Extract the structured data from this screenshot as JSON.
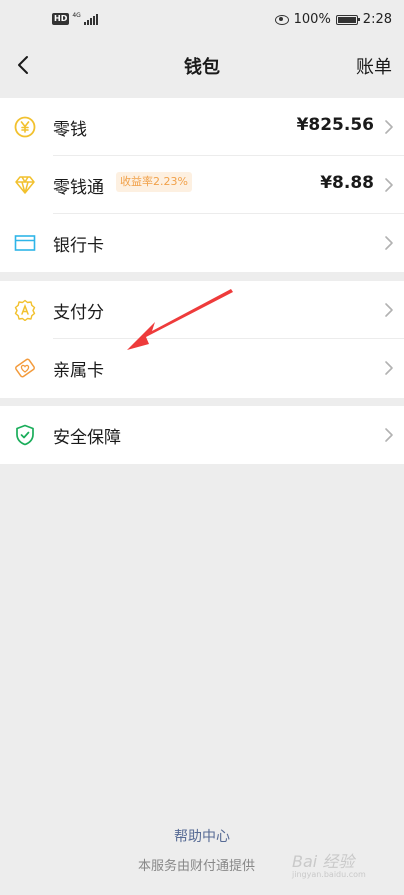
{
  "status_bar": {
    "hd": "HD",
    "network": "4G",
    "battery_percent": "100%",
    "time": "2:28"
  },
  "nav": {
    "title": "钱包",
    "right_link": "账单",
    "back_icon": "chevron-left-icon"
  },
  "groups": [
    {
      "rows": [
        {
          "label": "零钱",
          "value": "¥825.56",
          "icon": "yuan-coin-icon",
          "icon_color": "#f2c12e"
        },
        {
          "label": "零钱通",
          "value": "¥8.88",
          "badge": "收益率2.23%",
          "icon": "diamond-icon",
          "icon_color": "#f2c12e"
        },
        {
          "label": "银行卡",
          "value": "",
          "icon": "bank-card-icon",
          "icon_color": "#2fb5e8"
        }
      ]
    },
    {
      "rows": [
        {
          "label": "支付分",
          "value": "",
          "icon": "pay-score-icon",
          "icon_color": "#f2c12e"
        },
        {
          "label": "亲属卡",
          "value": "",
          "icon": "family-card-icon",
          "icon_color": "#f39b3c"
        }
      ]
    },
    {
      "rows": [
        {
          "label": "安全保障",
          "value": "",
          "icon": "shield-check-icon",
          "icon_color": "#1aad5a"
        }
      ]
    }
  ],
  "footer": {
    "help_link": "帮助中心",
    "provider_text": "本服务由财付通提供"
  },
  "watermark": {
    "text": "Bai 经验",
    "sub": "jingyan.baidu.com"
  },
  "colors": {
    "link": "#576b95",
    "annotation_arrow": "#ee3b3b",
    "badge_bg": "#fdf0e1",
    "badge_text": "#f1a14a"
  }
}
